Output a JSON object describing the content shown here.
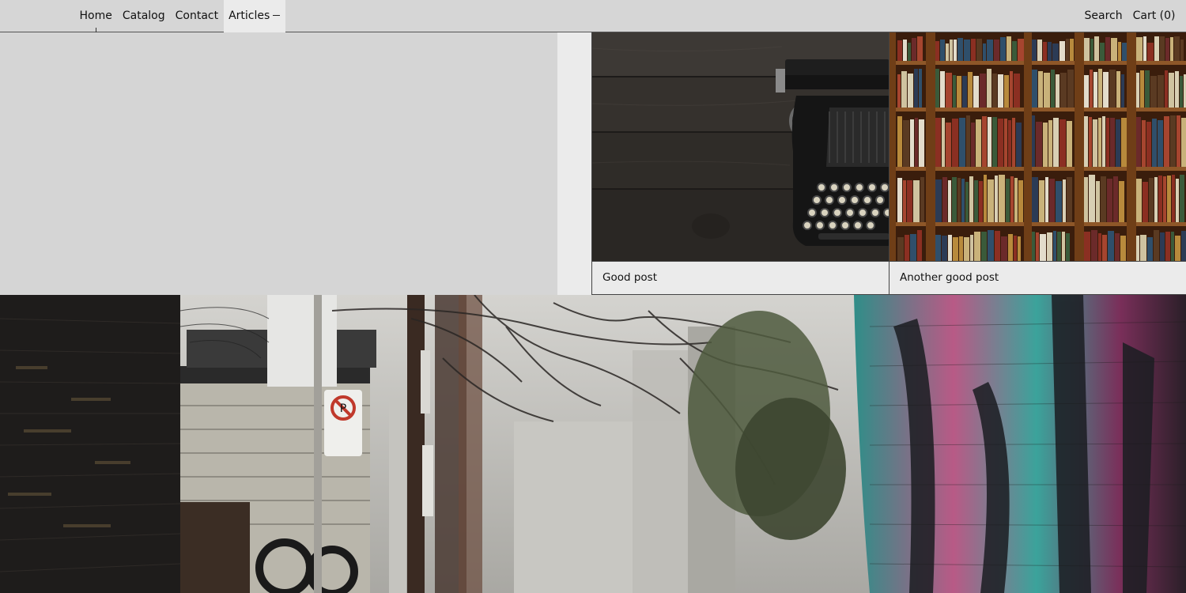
{
  "header": {
    "nav_left": [
      {
        "label": "Home"
      },
      {
        "label": "Catalog"
      },
      {
        "label": "Contact"
      },
      {
        "label": "Articles"
      }
    ],
    "nav_right": [
      {
        "label": "Search"
      },
      {
        "label": "Cart (0)"
      }
    ]
  },
  "articles": [
    {
      "title": "Good post",
      "image": "typewriter-photo"
    },
    {
      "title": "Another good post",
      "image": "bookshelf-photo"
    }
  ],
  "hero": {
    "image": "graffiti-alley-photo"
  },
  "colors": {
    "header_bg": "#d6d6d6",
    "active_nav_bg": "#ebebeb",
    "card_bg": "#ebebeb",
    "page_bg": "#d5d5d5"
  }
}
